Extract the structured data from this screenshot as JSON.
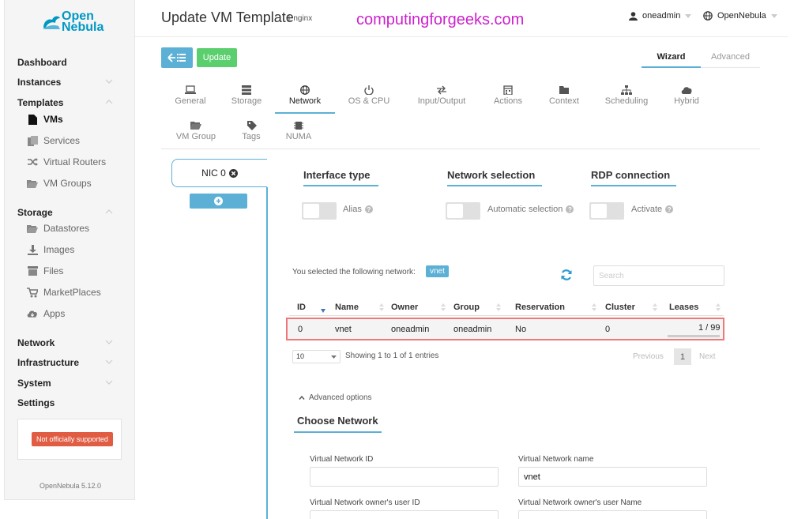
{
  "brand": {
    "line1": "Open",
    "line2": "Nebula"
  },
  "sidebar": {
    "dashboard": "Dashboard",
    "instances": "Instances",
    "templates": "Templates",
    "template_items": [
      "VMs",
      "Services",
      "Virtual Routers",
      "VM Groups"
    ],
    "storage": "Storage",
    "storage_items": [
      "Datastores",
      "Images",
      "Files",
      "MarketPlaces",
      "Apps"
    ],
    "network": "Network",
    "infrastructure": "Infrastructure",
    "system": "System",
    "settings": "Settings",
    "support_badge": "Not officially supported",
    "version": "OpenNebula 5.12.0"
  },
  "header": {
    "title": "Update VM Template",
    "subtitle": "1 nginx",
    "watermark": "computingforgeeks.com",
    "user": "oneadmin",
    "zone": "OpenNebula"
  },
  "toolbar": {
    "update_label": "Update"
  },
  "modes": {
    "wizard": "Wizard",
    "advanced": "Advanced"
  },
  "tabs": [
    "General",
    "Storage",
    "Network",
    "OS & CPU",
    "Input/Output",
    "Actions",
    "Context",
    "Scheduling",
    "Hybrid",
    "VM Group",
    "Tags",
    "NUMA"
  ],
  "nic": {
    "label": "NIC 0"
  },
  "groups": {
    "interface_type": "Interface type",
    "network_selection": "Network selection",
    "rdp_connection": "RDP connection"
  },
  "switches": {
    "alias": "Alias",
    "automatic_selection": "Automatic selection",
    "activate": "Activate"
  },
  "selection": {
    "text": "You selected the following network:",
    "network": "vnet"
  },
  "search": {
    "placeholder": "Search"
  },
  "table": {
    "headers": [
      "ID",
      "Name",
      "Owner",
      "Group",
      "Reservation",
      "Cluster",
      "Leases"
    ],
    "rows": [
      {
        "id": "0",
        "name": "vnet",
        "owner": "oneadmin",
        "group": "oneadmin",
        "reservation": "No",
        "cluster": "0",
        "leases": "1 / 99"
      }
    ]
  },
  "pagination": {
    "page_size": "10",
    "showing": "Showing 1 to 1 of 1 entries",
    "previous": "Previous",
    "current": "1",
    "next": "Next"
  },
  "advanced_options": "Advanced options",
  "choose_network": "Choose Network",
  "fields": {
    "vnet_id_label": "Virtual Network ID",
    "vnet_id_value": "",
    "vnet_name_label": "Virtual Network name",
    "vnet_name_value": "vnet",
    "owner_id_label": "Virtual Network owner's user ID",
    "owner_name_label": "Virtual Network owner's user Name"
  },
  "colors": {
    "accent": "#5cb0d6",
    "success": "#5bce6d",
    "danger": "#e05d44",
    "highlight": "#f07878",
    "watermark": "#cc22cc"
  }
}
